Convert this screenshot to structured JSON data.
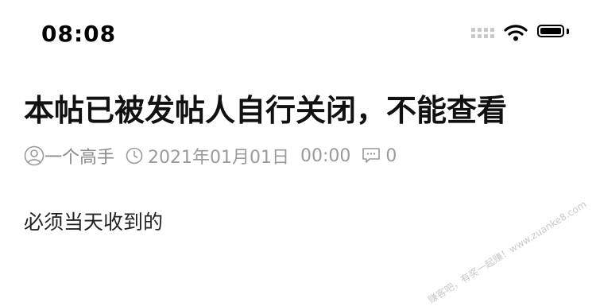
{
  "status_bar": {
    "time": "08:08",
    "icons": [
      "signal-dots-icon",
      "wifi-icon",
      "battery-icon"
    ]
  },
  "post": {
    "title": "本帖已被发帖人自行关闭，不能查看",
    "author": "一个高手",
    "date": "2021年01月01日",
    "time": "00:00",
    "comments": "0",
    "body": "必须当天收到的"
  },
  "watermark": {
    "text": "赚客吧，有奖一起赚！www.zuanke8.com"
  },
  "colors": {
    "meta": "#9a9a9a",
    "text": "#111111",
    "background": "#ffffff"
  }
}
